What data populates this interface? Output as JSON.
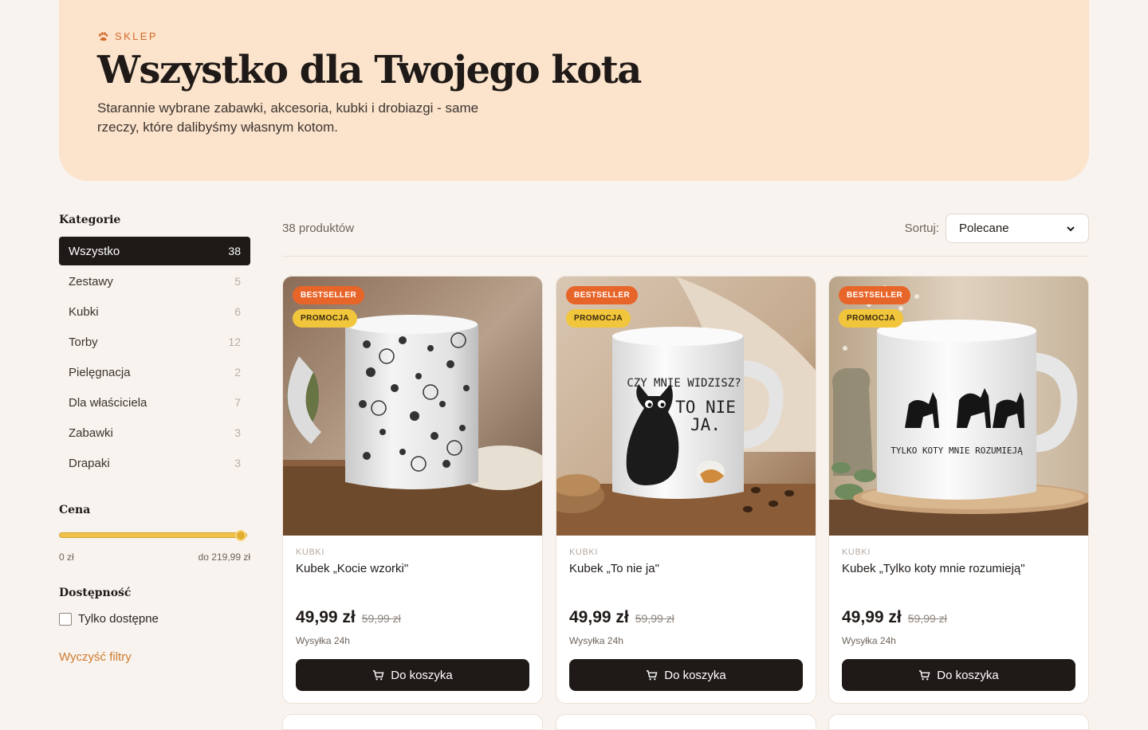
{
  "hero": {
    "eyebrow": "SKLEP",
    "title": "Wszystko dla Twojego kota",
    "description": "Starannie wybrane zabawki, akcesoria, kubki i drobiazgi - same rzeczy, które dalibyśmy własnym kotom."
  },
  "sidebar": {
    "categories_heading": "Kategorie",
    "categories": [
      {
        "label": "Wszystko",
        "count": "38",
        "active": true
      },
      {
        "label": "Zestawy",
        "count": "5"
      },
      {
        "label": "Kubki",
        "count": "6"
      },
      {
        "label": "Torby",
        "count": "12"
      },
      {
        "label": "Pielęgnacja",
        "count": "2"
      },
      {
        "label": "Dla właściciela",
        "count": "7"
      },
      {
        "label": "Zabawki",
        "count": "3"
      },
      {
        "label": "Drapaki",
        "count": "3"
      }
    ],
    "price_heading": "Cena",
    "price_min_label": "0 zł",
    "price_max_label": "do 219,99 zł",
    "availability_heading": "Dostępność",
    "only_available_label": "Tylko dostępne",
    "only_available_checked": false,
    "clear_filters_label": "Wyczyść filtry"
  },
  "toolbar": {
    "count_label": "38 produktów",
    "sort_label": "Sortuj:",
    "sort_value": "Polecane"
  },
  "products": [
    {
      "badges": [
        "BESTSELLER",
        "PROMOCJA"
      ],
      "category": "KUBKI",
      "name": "Kubek „Kocie wzorki\"",
      "price": "49,99 zł",
      "old_price": "59,99 zł",
      "shipping": "Wysyłka 24h",
      "cta": "Do koszyka"
    },
    {
      "badges": [
        "BESTSELLER",
        "PROMOCJA"
      ],
      "category": "KUBKI",
      "name": "Kubek „To nie ja\"",
      "price": "49,99 zł",
      "old_price": "59,99 zł",
      "shipping": "Wysyłka 24h",
      "cta": "Do koszyka",
      "mug_text": [
        "CZY MNIE WIDZISZ?",
        "TO NIE",
        "JA."
      ]
    },
    {
      "badges": [
        "BESTSELLER",
        "PROMOCJA"
      ],
      "category": "KUBKI",
      "name": "Kubek „Tylko koty mnie rozumieją\"",
      "price": "49,99 zł",
      "old_price": "59,99 zł",
      "shipping": "Wysyłka 24h",
      "cta": "Do koszyka",
      "mug_text": [
        "TYLKO KOTY MNIE ROZUMIEJĄ"
      ]
    }
  ],
  "colors": {
    "accent": "#d46a2a",
    "dark": "#1f1a17",
    "hero_bg": "#fbe3cc",
    "badge_bestseller": "#e8652a",
    "badge_promo": "#f2c63c"
  },
  "icons": [
    "paw-icon",
    "cart-icon",
    "chevron-down-icon"
  ]
}
